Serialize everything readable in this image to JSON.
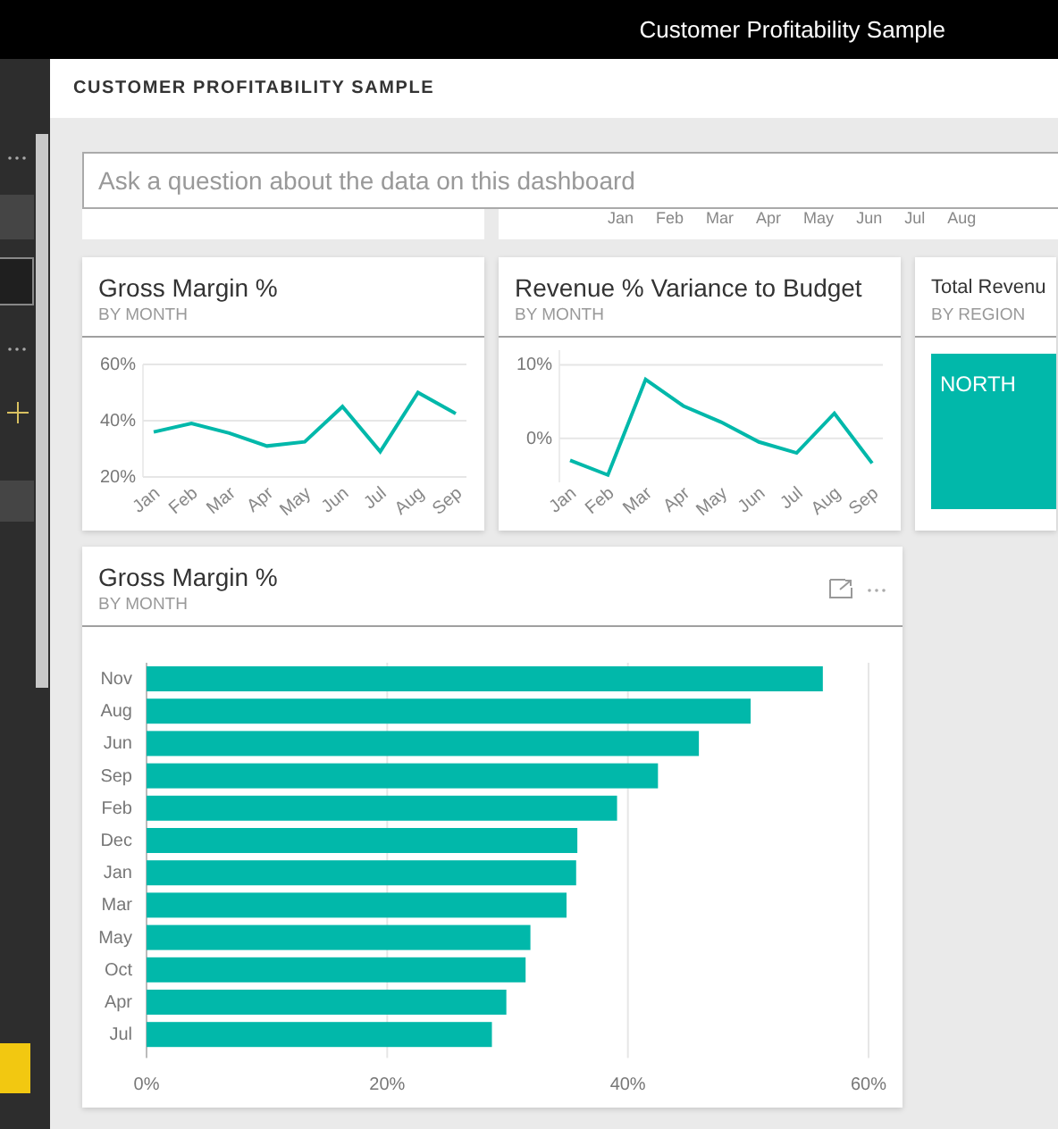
{
  "top_bar": {
    "title": "Customer Profitability Sample"
  },
  "header": {
    "title": "CUSTOMER PROFITABILITY SAMPLE"
  },
  "qna": {
    "placeholder": "Ask a question about the data on this dashboard"
  },
  "cut_tile": {
    "axis_labels": [
      "Jan",
      "Feb",
      "Mar",
      "Apr",
      "May",
      "Jun",
      "Jul",
      "Aug"
    ]
  },
  "tiles": [
    {
      "kind": "line",
      "title": "Gross Margin %",
      "subtitle": "BY MONTH",
      "chart_data": {
        "type": "line",
        "categories": [
          "Jan",
          "Feb",
          "Mar",
          "Apr",
          "May",
          "Jun",
          "Jul",
          "Aug",
          "Sep"
        ],
        "series": [
          {
            "color": "#01b8aa",
            "values": [
              36,
              39,
              35.6,
              31,
              32.5,
              45,
              29,
              50,
              42.5
            ]
          }
        ],
        "ylim": [
          20,
          60
        ],
        "yticks": [
          {
            "value": 20,
            "label": "20%"
          },
          {
            "value": 40,
            "label": "40%"
          },
          {
            "value": 60,
            "label": "60%"
          }
        ]
      }
    },
    {
      "kind": "line",
      "title": "Revenue % Variance to Budget",
      "subtitle": "BY MONTH",
      "chart_data": {
        "type": "line",
        "categories": [
          "Jan",
          "Feb",
          "Mar",
          "Apr",
          "May",
          "Jun",
          "Jul",
          "Aug",
          "Sep"
        ],
        "series": [
          {
            "color": "#01b8aa",
            "values": [
              -3,
              -5,
              8,
              4.4,
              2.2,
              -0.5,
              -2,
              3.4,
              -3.4
            ]
          }
        ],
        "ylim": [
          -6,
          12
        ],
        "yticks": [
          {
            "value": 0,
            "label": "0%"
          },
          {
            "value": 10,
            "label": "10%"
          }
        ]
      }
    },
    {
      "kind": "treemap",
      "title": "Total Revenu",
      "subtitle": "BY REGION",
      "region": "NORTH"
    }
  ],
  "bar_tile": {
    "title": "Gross Margin %",
    "subtitle": "BY MONTH",
    "chart_data": {
      "type": "bar",
      "orientation": "horizontal",
      "categories": [
        "Nov",
        "Aug",
        "Jun",
        "Sep",
        "Feb",
        "Dec",
        "Jan",
        "Mar",
        "May",
        "Oct",
        "Apr",
        "Jul"
      ],
      "series": [
        {
          "color": "#01b8aa",
          "values": [
            56.2,
            50.2,
            45.9,
            42.5,
            39.1,
            35.8,
            35.7,
            34.9,
            31.9,
            31.5,
            29.9,
            28.7
          ]
        }
      ],
      "xlim": [
        0,
        60
      ],
      "xticks": [
        {
          "value": 0,
          "label": "0%"
        },
        {
          "value": 20,
          "label": "20%"
        },
        {
          "value": 40,
          "label": "40%"
        },
        {
          "value": 60,
          "label": "60%"
        }
      ]
    }
  }
}
